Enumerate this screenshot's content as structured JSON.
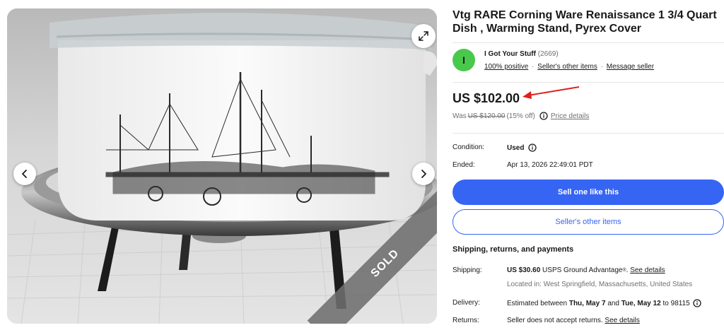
{
  "listing": {
    "title": "Vtg RARE Corning Ware Renaissance 1 3/4 Quart Dish , Warming Stand, Pyrex Cover",
    "sold_badge": "SOLD"
  },
  "seller": {
    "avatar_letter": "I",
    "avatar_color": "#49c94b",
    "name": "I Got Your Stuff",
    "feedback_count": "(2669)",
    "positive": "100% positive",
    "other_items_link": "Seller's other items",
    "message_link": "Message seller",
    "separator": "·"
  },
  "price": {
    "current": "US $102.00",
    "was_label": "Was",
    "was_price": "US $120.00",
    "discount": "(15% off)",
    "details_link": "Price details"
  },
  "details": {
    "condition_label": "Condition:",
    "condition_value": "Used",
    "ended_label": "Ended:",
    "ended_value": "Apr 13, 2026 22:49:01 PDT"
  },
  "buttons": {
    "sell_one": "Sell one like this",
    "seller_other_items": "Seller's other items"
  },
  "shipping": {
    "heading": "Shipping, returns, and payments",
    "shipping_label": "Shipping:",
    "shipping_cost": "US $30.60",
    "shipping_service": "USPS Ground Advantage",
    "shipping_reg": "®",
    "shipping_sep": ".",
    "shipping_link": "See details",
    "location": "Located in: West Springfield, Massachusetts, United States",
    "delivery_label": "Delivery:",
    "delivery_prefix": "Estimated between",
    "delivery_start": "Thu, May 7",
    "delivery_and": "and",
    "delivery_end": "Tue, May 12",
    "delivery_to": "to 98115",
    "returns_label": "Returns:",
    "returns_text": "Seller does not accept returns.",
    "returns_link": "See details"
  },
  "colors": {
    "primary_blue": "#3665f3",
    "text": "#191919",
    "muted": "#707070",
    "arrow_red": "#e0201c"
  },
  "icons": [
    "expand-icon",
    "chevron-left-icon",
    "chevron-right-icon",
    "info-icon"
  ]
}
